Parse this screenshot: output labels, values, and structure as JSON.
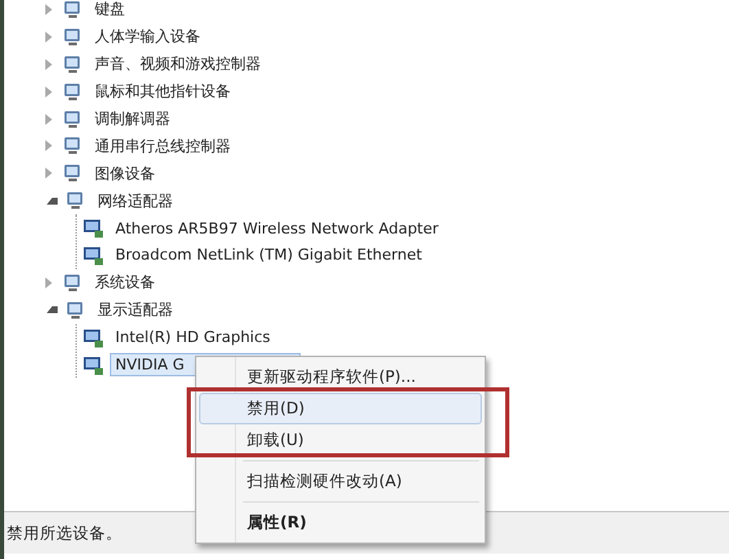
{
  "tree": [
    {
      "label": "键盘",
      "expanded": false,
      "selected": false
    },
    {
      "label": "人体学输入设备",
      "expanded": false,
      "selected": false
    },
    {
      "label": "声音、视频和游戏控制器",
      "expanded": false,
      "selected": false
    },
    {
      "label": "鼠标和其他指针设备",
      "expanded": false,
      "selected": false
    },
    {
      "label": "调制解调器",
      "expanded": false,
      "selected": false
    },
    {
      "label": "通用串行总线控制器",
      "expanded": false,
      "selected": false
    },
    {
      "label": "图像设备",
      "expanded": false,
      "selected": false
    },
    {
      "label": "网络适配器",
      "expanded": true,
      "selected": false,
      "children": [
        {
          "label": "Atheros AR5B97 Wireless Network Adapter",
          "selected": false
        },
        {
          "label": "Broadcom NetLink (TM) Gigabit Ethernet",
          "selected": false
        }
      ]
    },
    {
      "label": "系统设备",
      "expanded": false,
      "selected": false
    },
    {
      "label": "显示适配器",
      "expanded": true,
      "selected": false,
      "children": [
        {
          "label": "Intel(R) HD Graphics",
          "selected": false
        },
        {
          "label": "NVIDIA G",
          "selected": true
        }
      ]
    }
  ],
  "context_menu": [
    {
      "kind": "item",
      "label": "更新驱动程序软件(P)...",
      "selected": false,
      "default": false
    },
    {
      "kind": "item",
      "label": "禁用(D)",
      "selected": true,
      "default": false
    },
    {
      "kind": "item",
      "label": "卸载(U)",
      "selected": false,
      "default": false
    },
    {
      "kind": "separator"
    },
    {
      "kind": "item",
      "label": "扫描检测硬件改动(A)",
      "selected": false,
      "default": false
    },
    {
      "kind": "separator"
    },
    {
      "kind": "item",
      "label": "属性(R)",
      "selected": false,
      "default": true
    }
  ],
  "status_bar": {
    "text": "禁用所选设备。"
  }
}
